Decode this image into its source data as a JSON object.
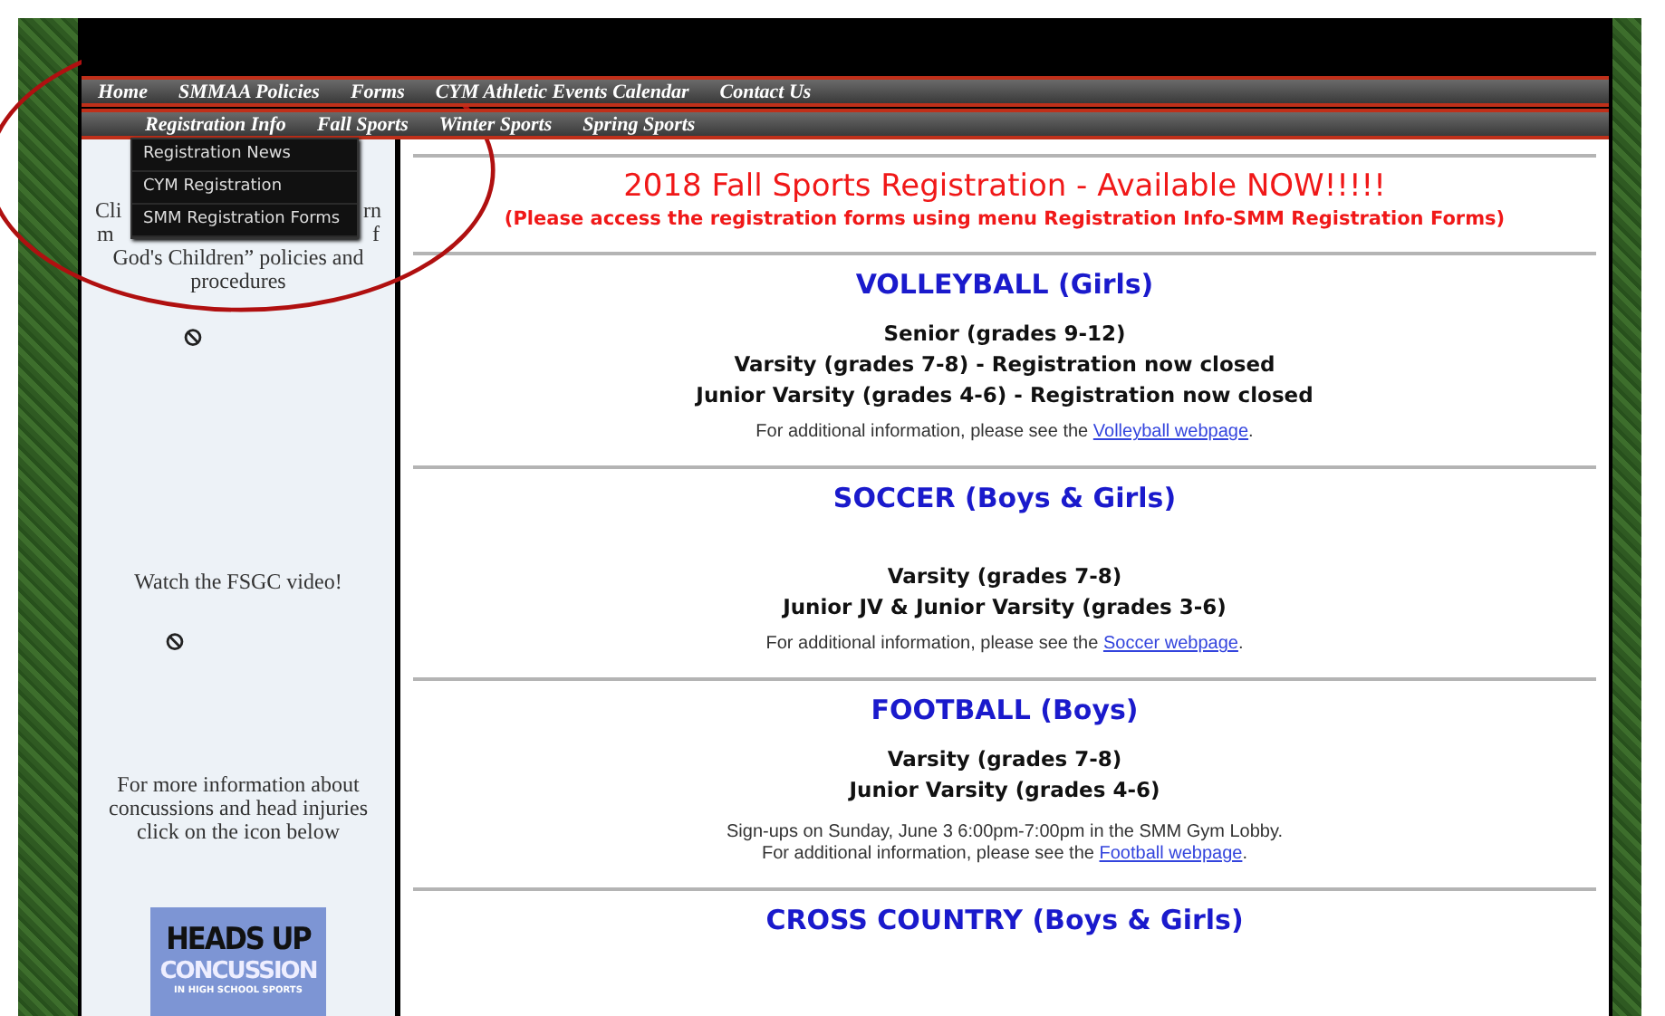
{
  "nav": {
    "primary": [
      {
        "label": "Home"
      },
      {
        "label": "SMMAA Policies"
      },
      {
        "label": "Forms"
      },
      {
        "label": "CYM Athletic Events Calendar"
      },
      {
        "label": "Contact Us"
      }
    ],
    "secondary": [
      {
        "label": "Registration Info"
      },
      {
        "label": "Fall Sports"
      },
      {
        "label": "Winter Sports"
      },
      {
        "label": "Spring Sports"
      }
    ],
    "dropdown": [
      {
        "label": "Registration News"
      },
      {
        "label": "CYM Registration"
      },
      {
        "label": "SMM Registration Forms"
      }
    ]
  },
  "sidebar": {
    "policy_fragments": [
      "Cli",
      "rn",
      "m",
      "f"
    ],
    "policy_text": "God's Children” policies and procedures",
    "video_text": "Watch the FSGC video!",
    "concussion_text": "For more information about concussions and head injuries click on the icon below",
    "logo": {
      "line_1": "HEADS UP",
      "line_2": "CONCUSSION",
      "line_3": "IN HIGH SCHOOL SPORTS"
    }
  },
  "notice": {
    "title": "2018 Fall Sports Registration - Available NOW!!!!!",
    "subtitle": "(Please access the registration forms using menu Registration Info-SMM Registration Forms)"
  },
  "sports": [
    {
      "title": "VOLLEYBALL (Girls)",
      "levels": [
        "Senior (grades 9-12)",
        "Varsity (grades 7-8) - Registration now closed",
        "Junior Varsity (grades 4-6) - Registration now closed"
      ],
      "info_prefix": "For additional information, please see the ",
      "link": "Volleyball webpage",
      "info_suffix": "."
    },
    {
      "title": "SOCCER (Boys & Girls)",
      "levels": [
        "Varsity (grades 7-8)",
        "Junior JV & Junior Varsity (grades 3-6)"
      ],
      "info_prefix": "For additional information, please see the ",
      "link": "Soccer webpage",
      "info_suffix": "."
    },
    {
      "title": "FOOTBALL (Boys)",
      "levels": [
        "Varsity (grades 7-8)",
        "Junior Varsity (grades 4-6)"
      ],
      "note": "Sign-ups on Sunday, June 3 6:00pm-7:00pm in the SMM Gym Lobby.",
      "info_prefix": "For additional information, please see the ",
      "link": "Football webpage",
      "info_suffix": "."
    },
    {
      "title": "CROSS COUNTRY (Boys & Girls)"
    }
  ]
}
